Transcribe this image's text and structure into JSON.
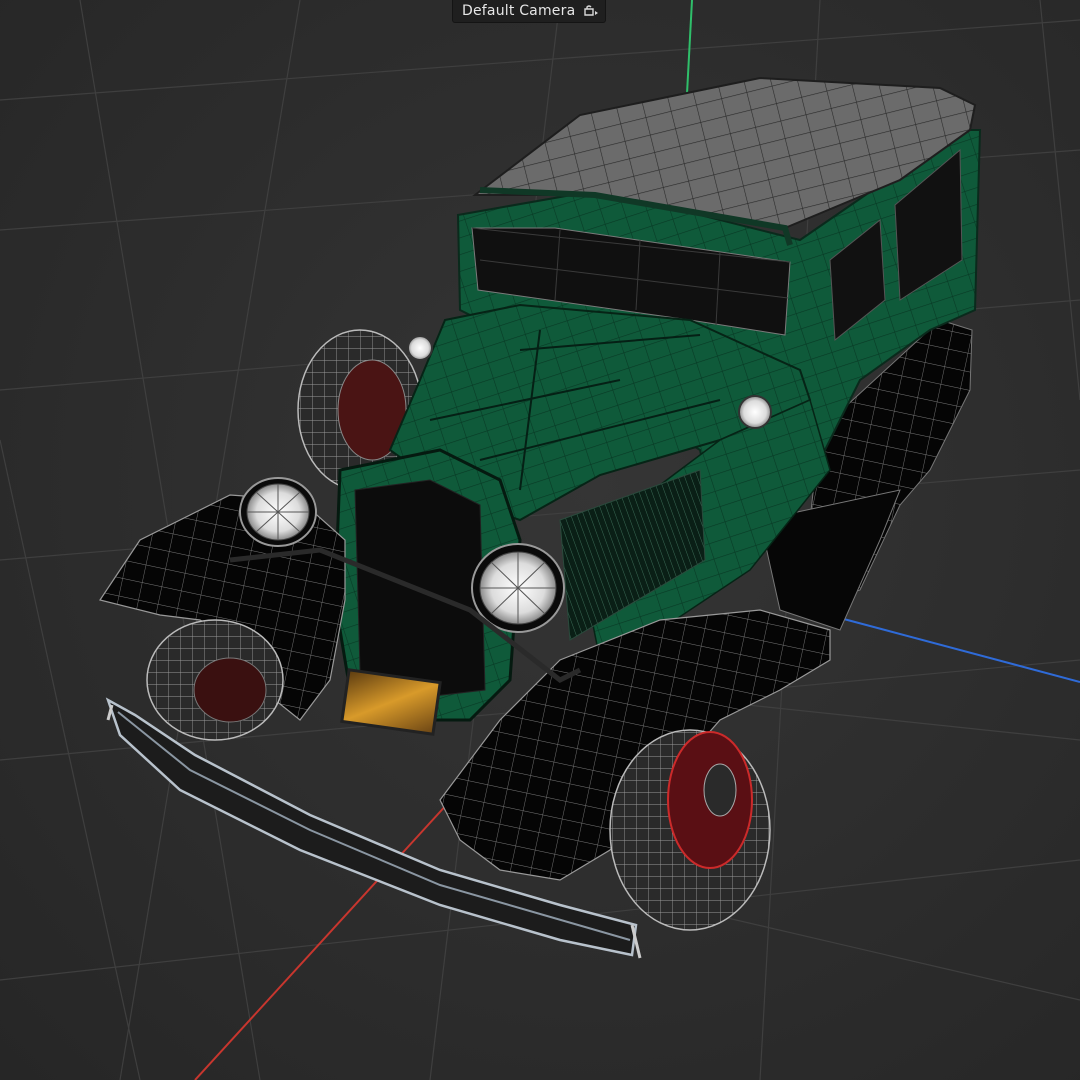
{
  "viewport": {
    "camera_label": "Default Camera",
    "camera_icon": "camera-lock-icon",
    "model": {
      "body_color": "#0f5a3a",
      "fender_color": "#060606",
      "roof_color": "#6e6e6e",
      "wire_color": "#8a8a8a"
    },
    "axes": {
      "x_color": "#c8362e",
      "y_color": "#2fbf6a",
      "z_color": "#2f6bd8"
    }
  }
}
